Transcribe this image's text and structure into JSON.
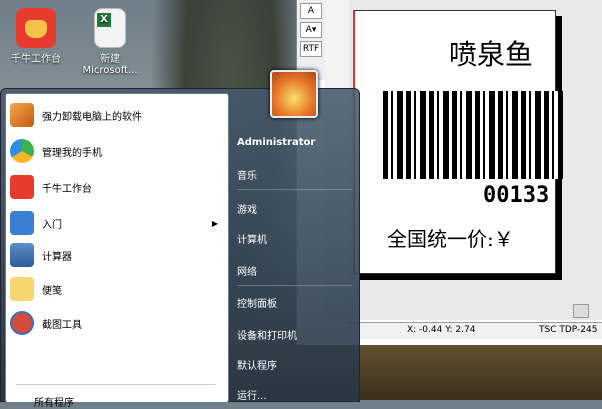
{
  "desktop": {
    "icons": [
      {
        "label": "千牛工作台",
        "icon": "qianniu-icon"
      },
      {
        "label": "新建 Microsoft...",
        "icon": "excel-file-icon"
      }
    ]
  },
  "label_app": {
    "toolbar": [
      "A",
      "A▾",
      "RTF"
    ],
    "label_title": "喷泉鱼",
    "barcode_digits": "00133",
    "price_text": "全国统一价:￥",
    "status": {
      "coords": "X: -0.44 Y:  2.74",
      "printer": "TSC TDP-245"
    }
  },
  "start_menu": {
    "pinned": [
      {
        "label": "强力卸载电脑上的软件",
        "icon": "uninstall-icon"
      },
      {
        "label": "管理我的手机",
        "icon": "phone-manager-icon"
      },
      {
        "label": "千牛工作台",
        "icon": "qianniu-icon"
      },
      {
        "label": "入门",
        "icon": "getting-started-icon",
        "submenu": true
      },
      {
        "label": "计算器",
        "icon": "calculator-icon"
      },
      {
        "label": "便笺",
        "icon": "sticky-notes-icon"
      },
      {
        "label": "截图工具",
        "icon": "snipping-tool-icon"
      }
    ],
    "all_programs": "所有程序",
    "user": "Administrator",
    "right_items": [
      "音乐",
      "游戏",
      "计算机",
      "网络",
      "控制面板",
      "设备和打印机",
      "默认程序",
      "运行..."
    ]
  },
  "colors": {
    "accent": "#e63b2e",
    "menu_glass": "#3f5366"
  }
}
